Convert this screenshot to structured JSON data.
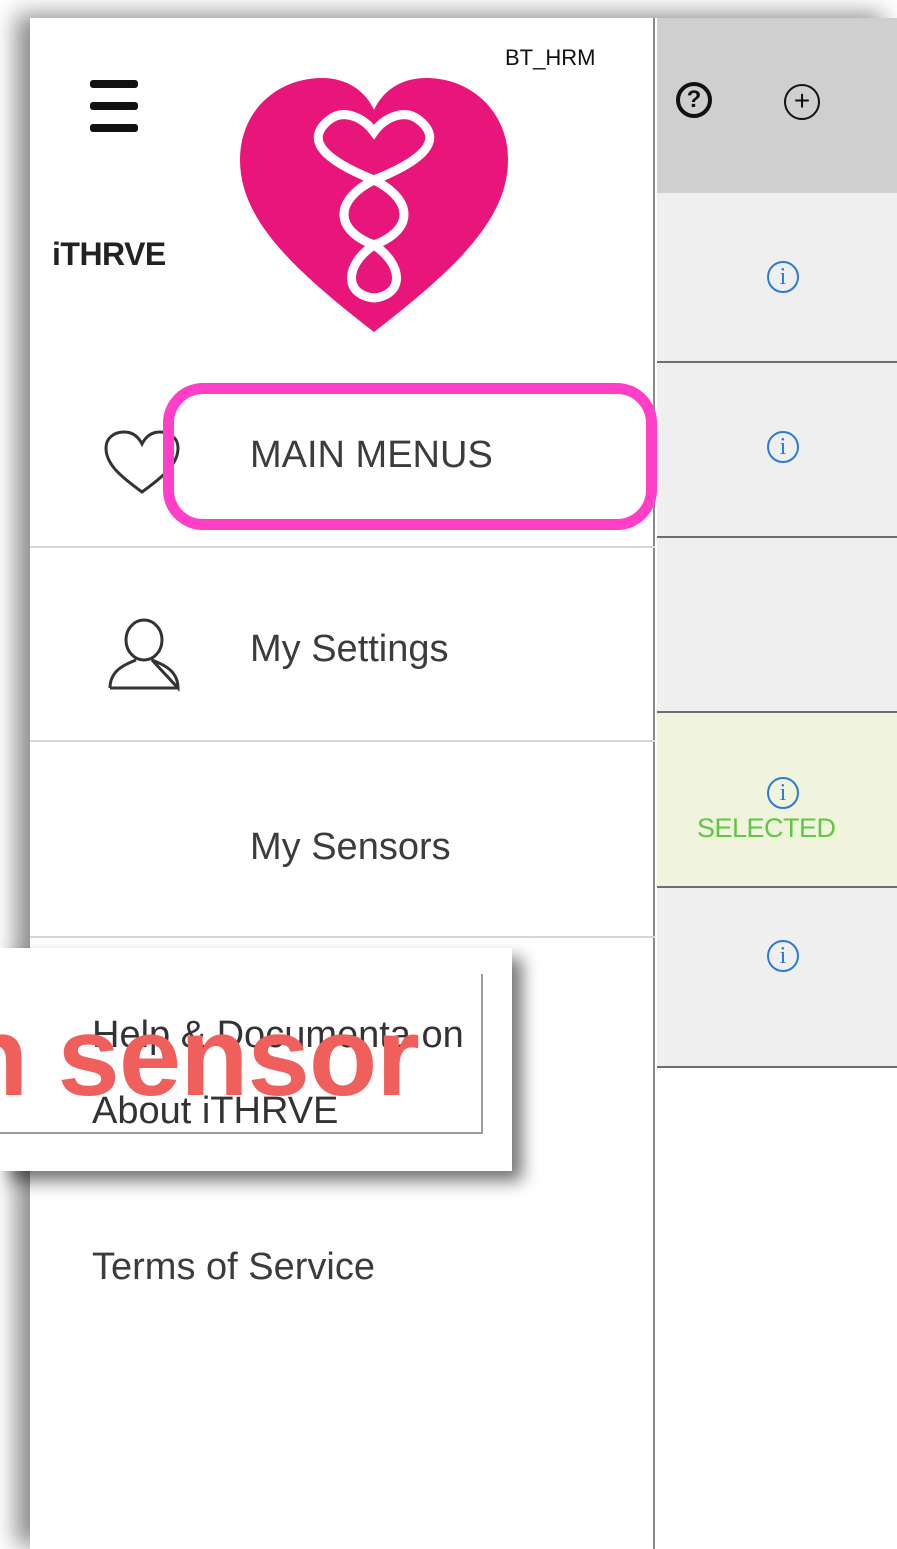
{
  "drawer": {
    "brand_name": "iTHRVE",
    "device_name": "BT_HRM",
    "menu": [
      {
        "label": "MAIN MENUS",
        "icon": "heart-outline-icon"
      },
      {
        "label": "My Settings",
        "icon": "person-icon"
      },
      {
        "label": "My Sensors",
        "icon": ""
      },
      {
        "label": "Help & Documentation",
        "icon": ""
      },
      {
        "label": "About iTHRVE",
        "icon": ""
      },
      {
        "label": "Terms of Service",
        "icon": ""
      }
    ]
  },
  "callout": {
    "help_text": "Help & Documenta   on",
    "about_text": "About iTHRVE",
    "overlay_text": "n sensor"
  },
  "header": {
    "help_glyph": "?",
    "add_glyph": "+"
  },
  "sensor_list": {
    "info_glyph": "i",
    "selected_label": "SELECTED"
  },
  "colors": {
    "highlight": "#ff3fc8",
    "brand_heart": "#e8167a",
    "overlay_text": "#ef5f5c",
    "selected_text": "#5fc743",
    "info_icon": "#2a7ad6",
    "selected_row": "#f0f4dc"
  }
}
